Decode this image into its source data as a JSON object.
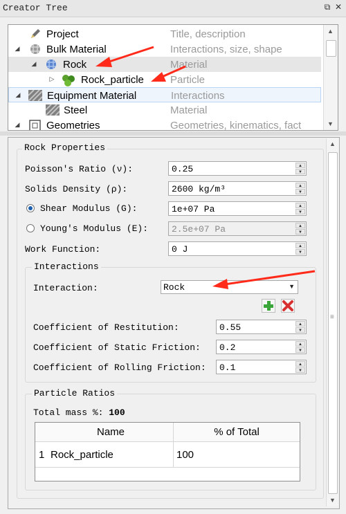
{
  "panel_title": "Creator Tree",
  "tree": {
    "rows": [
      {
        "label": "Project",
        "desc": "Title, description",
        "icon": "pencil-icon"
      },
      {
        "label": "Bulk Material",
        "desc": "Interactions, size, shape",
        "icon": "bulk-material-icon",
        "expander": "expanded"
      },
      {
        "label": "Rock",
        "desc": "Material",
        "icon": "rock-material-icon",
        "expander": "expanded",
        "selected": true
      },
      {
        "label": "Rock_particle",
        "desc": "Particle",
        "icon": "particle-icon",
        "expander": "collapsed"
      },
      {
        "label": "Equipment Material",
        "desc": "Interactions",
        "icon": "equipment-material-icon",
        "expander": "expanded"
      },
      {
        "label": "Steel",
        "desc": "Material",
        "icon": "steel-material-icon"
      },
      {
        "label": "Geometries",
        "desc": "Geometries, kinematics, fact",
        "icon": "geometries-icon",
        "expander": "expanded"
      }
    ]
  },
  "properties": {
    "group_title": "Rock Properties",
    "poisson_label": "Poisson's Ratio (ν):",
    "poisson_value": "0.25",
    "density_label": "Solids Density (ρ):",
    "density_value": "2600 kg/m³",
    "shear_label": "Shear Modulus (G):",
    "shear_value": "1e+07 Pa",
    "young_label": "Young's Modulus (E):",
    "young_value": "2.5e+07 Pa",
    "work_label": "Work Function:",
    "work_value": "0 J",
    "selected_modulus": "shear"
  },
  "interactions": {
    "group_title": "Interactions",
    "interaction_label": "Interaction:",
    "interaction_value": "Rock",
    "restitution_label": "Coefficient of Restitution:",
    "restitution_value": "0.55",
    "static_label": "Coefficient of Static Friction:",
    "static_value": "0.2",
    "rolling_label": "Coefficient of Rolling Friction:",
    "rolling_value": "0.1"
  },
  "ratios": {
    "group_title": "Particle Ratios",
    "total_label": "Total mass %:",
    "total_value": "100",
    "columns": [
      "Name",
      "% of Total"
    ],
    "rows": [
      {
        "index": "1",
        "name": "Rock_particle",
        "percent": "100"
      }
    ]
  },
  "colors": {
    "annotation_arrow": "#ff2a1a",
    "add_icon": "#3aa63a",
    "delete_icon": "#d83030"
  }
}
